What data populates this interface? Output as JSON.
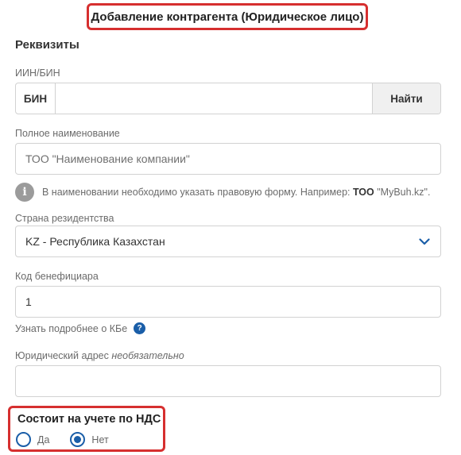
{
  "header": {
    "title": "Добавление контрагента (Юридическое лицо)"
  },
  "section": {
    "title": "Реквизиты"
  },
  "iin": {
    "label": "ИИН/БИН",
    "prefix": "БИН",
    "value": "",
    "button": "Найти"
  },
  "full_name": {
    "label": "Полное наименование",
    "placeholder": "ТОО \"Наименование компании\""
  },
  "hint": {
    "text_before": "В наименовании необходимо указать правовую форму. Например: ",
    "bold": "ТОО",
    "text_after": " \"MyBuh.kz\"."
  },
  "country": {
    "label": "Страна резидентства",
    "selected": "KZ - Республика Казахстан"
  },
  "beneficiary": {
    "label": "Код бенефициара",
    "value": "1"
  },
  "kbe": {
    "link": "Узнать подробнее о КБе"
  },
  "address": {
    "label": "Юридический адрес",
    "optional": "необязательно",
    "value": ""
  },
  "vat": {
    "title": "Состоит на учете по НДС",
    "options": [
      {
        "label": "Да",
        "selected": false
      },
      {
        "label": "Нет",
        "selected": true
      }
    ]
  },
  "colors": {
    "accent": "#1a5ea8",
    "highlight": "#d62f2f"
  },
  "icons": {
    "info": "info-icon",
    "question": "question-icon",
    "chevron": "chevron-down-icon"
  }
}
